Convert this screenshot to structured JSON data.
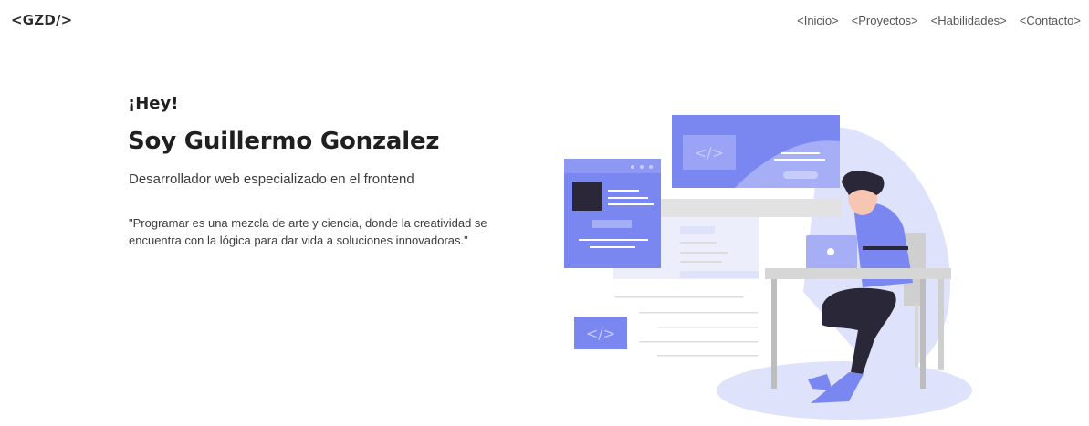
{
  "header": {
    "logo": "<GZD/>",
    "nav": [
      {
        "label": "<Inicio>"
      },
      {
        "label": "<Proyectos>"
      },
      {
        "label": "<Habilidades>"
      },
      {
        "label": "<Contacto>"
      }
    ]
  },
  "hero": {
    "greeting": "¡Hey!",
    "name": "Soy Guillermo Gonzalez",
    "role": "Desarrollador web especializado en el frontend",
    "quote": "\"Programar es una mezcla de arte y ciencia, donde la creatividad se encuentra con la lógica para dar vida a soluciones innovadoras.\""
  },
  "illustration": {
    "code_glyph": "</>",
    "colors": {
      "accent": "#7b87f0",
      "accent_light": "#a6aef5",
      "blob": "#dfe2fb",
      "dark": "#2a2838",
      "gray": "#d6d6d6"
    }
  }
}
